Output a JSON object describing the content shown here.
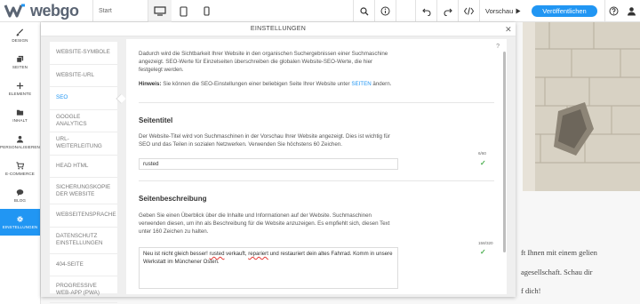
{
  "topbar": {
    "logo_text": "webgo",
    "page_select": "Start",
    "device_icons": [
      "desktop-icon",
      "tablet-icon",
      "phone-icon"
    ],
    "preview_label": "Vorschau",
    "publish_label": "Veröffentlichen"
  },
  "sidebar": {
    "items": [
      {
        "label": "DESIGN",
        "icon": "brush-icon"
      },
      {
        "label": "SEITEN",
        "icon": "pages-icon"
      },
      {
        "label": "ELEMENTE",
        "icon": "plus-icon"
      },
      {
        "label": "INHALT",
        "icon": "folder-icon"
      },
      {
        "label": "PERSONALISIEREN",
        "icon": "person-icon"
      },
      {
        "label": "E-COMMERCE",
        "icon": "cart-icon"
      },
      {
        "label": "BLOG",
        "icon": "chat-icon"
      },
      {
        "label": "EINSTELLUNGEN",
        "icon": "gear-icon"
      }
    ],
    "active": "EINSTELLUNGEN"
  },
  "site": {
    "text_lines": [
      "ft Ihnen mit einem gelien",
      "agesellschaft. Schau dir",
      "f dich!"
    ]
  },
  "dialog": {
    "title": "EINSTELLUNGEN",
    "nav": [
      "WEBSITE-SYMBOLE",
      "WEBSITE-URL",
      "SEO",
      "GOOGLE ANALYTICS",
      "URL-WEITERLEITUNG",
      "HEAD HTML",
      "SICHERUNGSKOPIE DER WEBSITE",
      "WEBSEITENSPRACHE",
      "DATENSCHUTZ EINSTELLUNGEN",
      "404-SEITE",
      "PROGRESSIVE WEB-APP (PWA)"
    ],
    "active_nav": "SEO",
    "panel": {
      "help": "?",
      "intro": "Dadurch wird die Sichtbarkeit Ihrer Website in den organischen Suchergebnissen einer Suchmaschine angezeigt. SEO-Werte für Einzelseiten überschreiben die globalen Website-SEO-Werte, die hier festgelegt werden.",
      "hint_label": "Hinweis:",
      "hint_text_before": "Sie können die SEO-Einstellungen einer beliebigen Seite Ihrer Website unter",
      "hint_link": "SEITEN",
      "hint_text_after": "ändern.",
      "title_section": {
        "heading": "Seitentitel",
        "description": "Der Website-Titel wird von Suchmaschinen in der Vorschau Ihrer Website angezeigt. Dies ist wichtig für SEO und das Teilen in sozialen Netzwerken. Verwenden Sie höchstens 60 Zeichen.",
        "counter": "6/60",
        "value": "rusted"
      },
      "desc_section": {
        "heading": "Seitenbeschreibung",
        "description": "Geben Sie einen Überblick über die Inhalte und Informationen auf der Website. Suchmaschinen verwenden diesen, um ihn als Beschreibung für die Website anzuzeigen. Es empfiehlt sich, diesen Text unter 160 Zeichen zu halten.",
        "counter": "158/320",
        "value_parts": [
          "Neu ist nicht gleich besser! ",
          "rusted",
          " verkauft, ",
          "repariert",
          " und restauriert dein altes Fahrrad. Komm in unsere Werkstatt im Münchener Osten."
        ]
      }
    }
  }
}
